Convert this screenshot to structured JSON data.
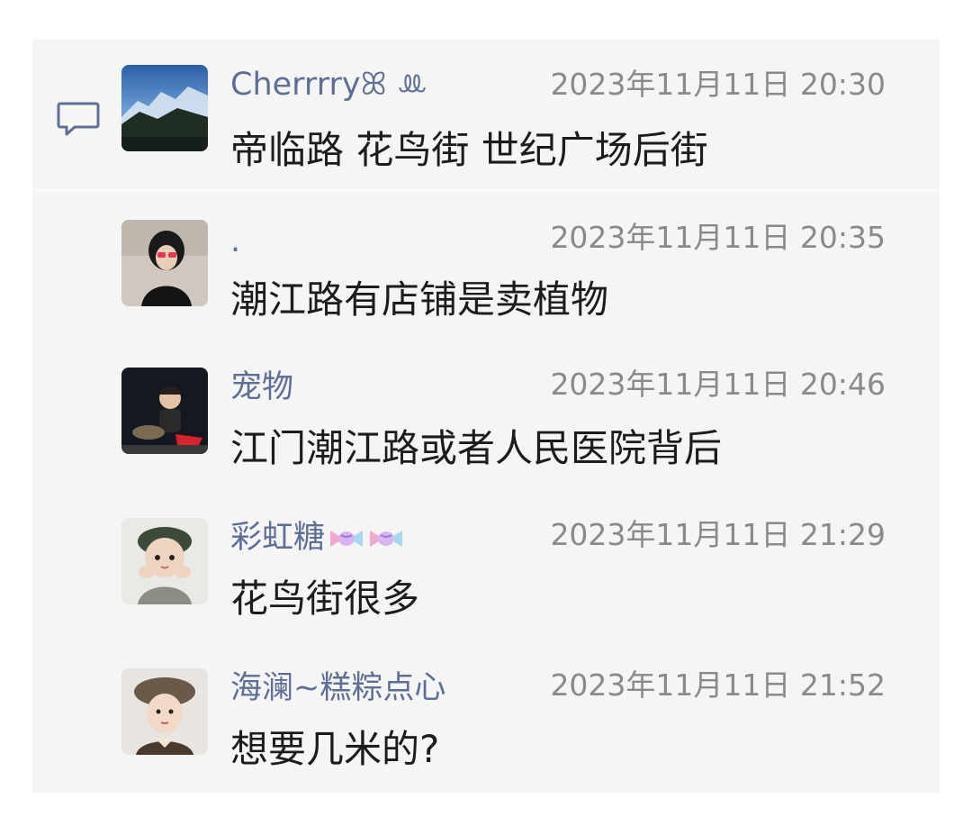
{
  "thread": {
    "main": {
      "name": "Cherrrryꕤ ꔛ",
      "time": "2023年11月11日 20:30",
      "text": "帝临路 花鸟街 世纪广场后街"
    },
    "replies": [
      {
        "name": ".",
        "time": "2023年11月11日 20:35",
        "text": "潮江路有店铺是卖植物"
      },
      {
        "name": "宠物",
        "time": "2023年11月11日 20:46",
        "text": "江门潮江路或者人民医院背后"
      },
      {
        "name": "彩虹糖",
        "name_emojis": [
          "candy-icon",
          "candy-icon"
        ],
        "time": "2023年11月11日 21:29",
        "text": "花鸟街很多"
      },
      {
        "name": "海澜~糕粽点心",
        "time": "2023年11月11日 21:52",
        "text": "想要几米的?"
      }
    ]
  },
  "colors": {
    "name": "#5f6f94",
    "time": "#8a8a8a",
    "text": "#1c1c1c",
    "panel_bg": "#f5f5f5",
    "icon_stroke": "#5f6f94"
  },
  "icons": {
    "comment": "comment-bubble-icon"
  }
}
